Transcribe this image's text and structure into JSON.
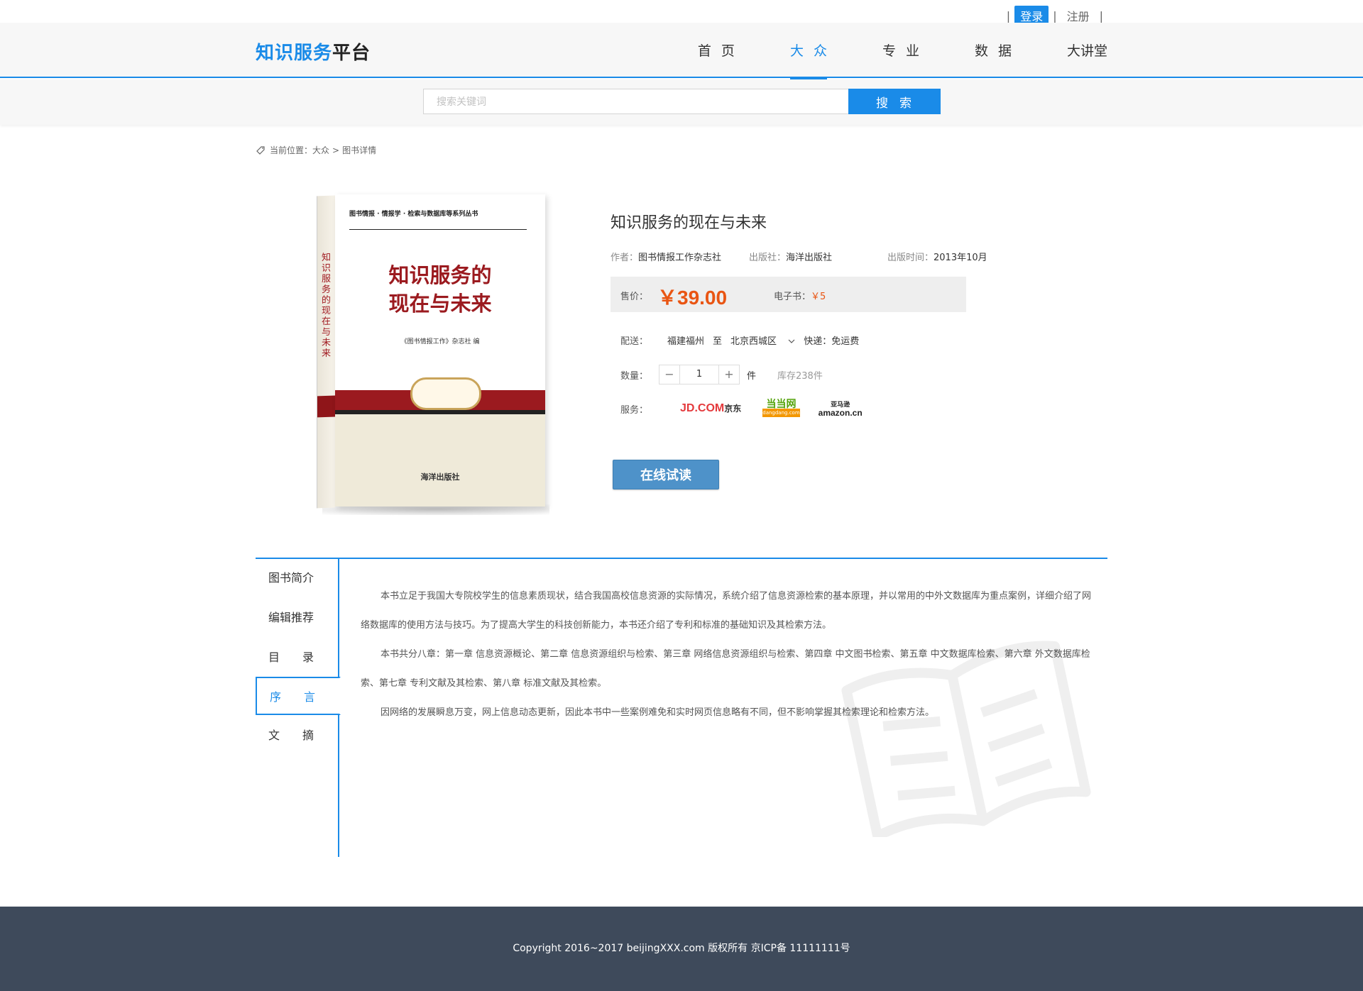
{
  "topbar": {
    "login": "登录",
    "register": "注册",
    "sep": "|"
  },
  "header": {
    "logo_blue": "知识服务",
    "logo_dark": "平台",
    "nav": [
      "首页",
      "大众",
      "专业",
      "数据",
      "大讲堂"
    ],
    "active_nav": "大众"
  },
  "search": {
    "placeholder": "搜索关键词",
    "button": "搜索"
  },
  "breadcrumb": {
    "prefix": "当前位置：大众",
    "arrow": ">",
    "current": "图书详情"
  },
  "cover": {
    "top_text": "图书情报 · 情报学 · 检索与数据库等系列丛书",
    "title_line1": "知识服务的",
    "title_line2": "现在与未来",
    "spine_title": "知识服务的现在与未来",
    "editor": "《图书情报工作》杂志社 编",
    "publisher": "海洋出版社"
  },
  "book": {
    "title": "知识服务的现在与未来",
    "author_label": "作者：",
    "author": "图书情报工作杂志社",
    "publisher_label": "出版社：",
    "publisher": "海洋出版社",
    "date_label": "出版时间：",
    "date": "2013年10月",
    "price_label": "售价：",
    "price": "￥39.00",
    "ebook_label": "电子书：",
    "ebook_price": "￥5",
    "delivery_label": "配送：",
    "delivery_from": "福建福州",
    "delivery_to_word": "至",
    "delivery_to": "北京西城区",
    "express": "快递：免运费",
    "qty_label": "数量：",
    "qty_minus": "−",
    "qty_value": "1",
    "qty_plus": "+",
    "qty_unit": "件",
    "stock": "库存238件",
    "service_label": "服务：",
    "service_jd": "JD.COM",
    "service_jd_cn": "京东",
    "service_dd": "当当网",
    "service_dd_sub": "dangdang.com",
    "service_amz_cn": "亚马逊",
    "service_amz": "amazon.cn",
    "read_button": "在线试读"
  },
  "tabs": [
    {
      "label": "图书简介"
    },
    {
      "label": "编辑推荐"
    },
    {
      "label": "目　　录"
    },
    {
      "label": "序　　言"
    },
    {
      "label": "文　　摘"
    }
  ],
  "active_tab": "序言",
  "detail": {
    "para1": "本书立足于我国大专院校学生的信息素质现状，结合我国高校信息资源的实际情况，系统介绍了信息资源检索的基本原理，并以常用的中外文数据库为重点案例，详细介绍了网络数据库的使用方法与技巧。为了提高大学生的科技创新能力，本书还介绍了专利和标准的基础知识及其检索方法。",
    "para2": "本书共分八章：第一章 信息资源概论、第二章 信息资源组织与检索、第三章 网络信息资源组织与检索、第四章 中文图书检索、第五章 中文数据库检索、第六章 外文数据库检索、第七章 专利文献及其检索、第八章 标准文献及其检索。",
    "para3": "因网络的发展瞬息万变，网上信息动态更新，因此本书中一些案例难免和实时网页信息略有不同，但不影响掌握其检索理论和检索方法。"
  },
  "footer": {
    "copyright": "Copyright 2016~2017 beijingXXX.com 版权所有 京ICP备 11111111号"
  },
  "colors": {
    "accent": "#1a8be8",
    "price": "#e95513",
    "footer_bg": "#3e4a5b",
    "read_button": "#4e92c9"
  }
}
